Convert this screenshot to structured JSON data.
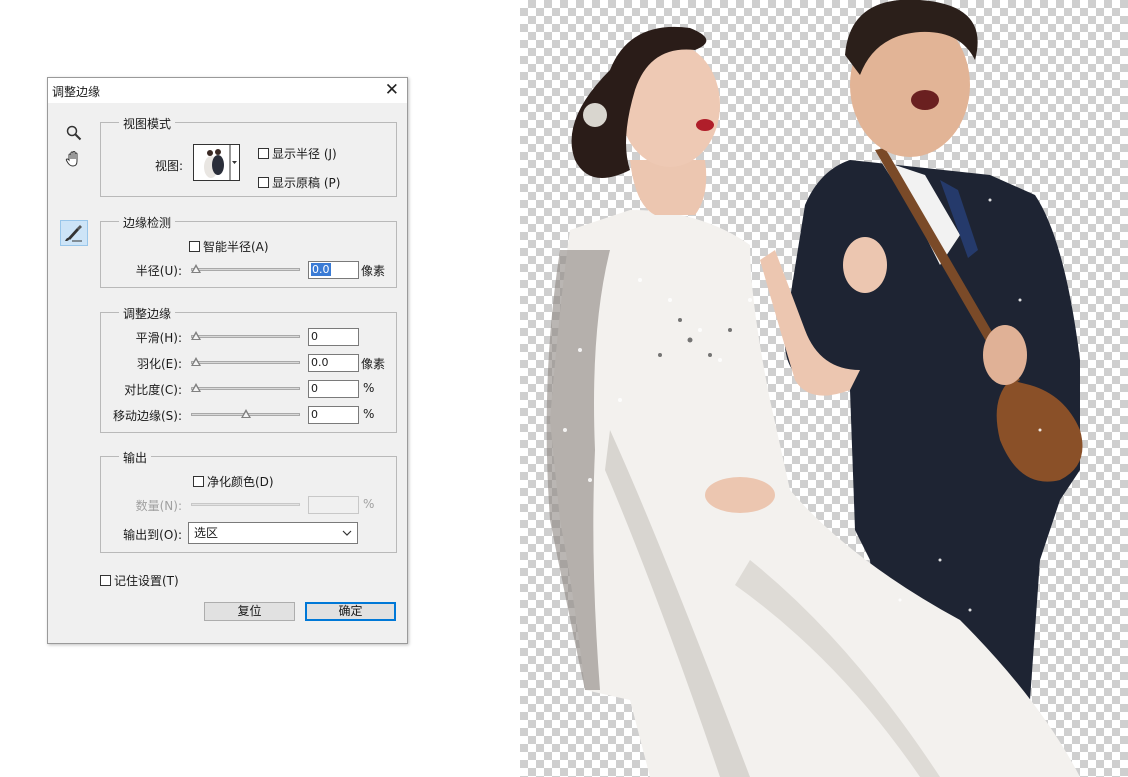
{
  "dialog": {
    "title": "调整边缘",
    "view_mode": {
      "legend": "视图模式",
      "view_label": "视图:",
      "show_radius": "显示半径 (J)",
      "show_original": "显示原稿 (P)",
      "show_radius_checked": false,
      "show_original_checked": false
    },
    "edge_detection": {
      "legend": "边缘检测",
      "smart_radius": "智能半径(A)",
      "smart_radius_checked": false,
      "radius_label": "半径(U):",
      "radius_value": "0.0",
      "radius_unit": "像素",
      "radius_slider": 0.0
    },
    "adjust_edge": {
      "legend": "调整边缘",
      "smooth_label": "平滑(H):",
      "smooth_value": "0",
      "smooth_slider": 0.0,
      "feather_label": "羽化(E):",
      "feather_value": "0.0",
      "feather_unit": "像素",
      "feather_slider": 0.0,
      "contrast_label": "对比度(C):",
      "contrast_value": "0",
      "contrast_unit": "%",
      "contrast_slider": 0.0,
      "shift_label": "移动边缘(S):",
      "shift_value": "0",
      "shift_unit": "%",
      "shift_slider": 0.5
    },
    "output": {
      "legend": "输出",
      "decontaminate": "净化颜色(D)",
      "decontaminate_checked": false,
      "amount_label": "数量(N):",
      "amount_value": "",
      "amount_unit": "%",
      "amount_slider": 0.0,
      "output_to_label": "输出到(O):",
      "output_to_value": "选区"
    },
    "remember": "记住设置(T)",
    "remember_checked": false,
    "reset_button": "复位",
    "ok_button": "确定"
  },
  "tools": {
    "zoom": "magnifier-icon",
    "hand": "hand-icon",
    "refine_brush": "refine-radius-brush-icon"
  },
  "colors": {
    "checker": "#cfcfcf",
    "selection_highlight": "#3a7bd5",
    "default_button_border": "#0078d7"
  }
}
